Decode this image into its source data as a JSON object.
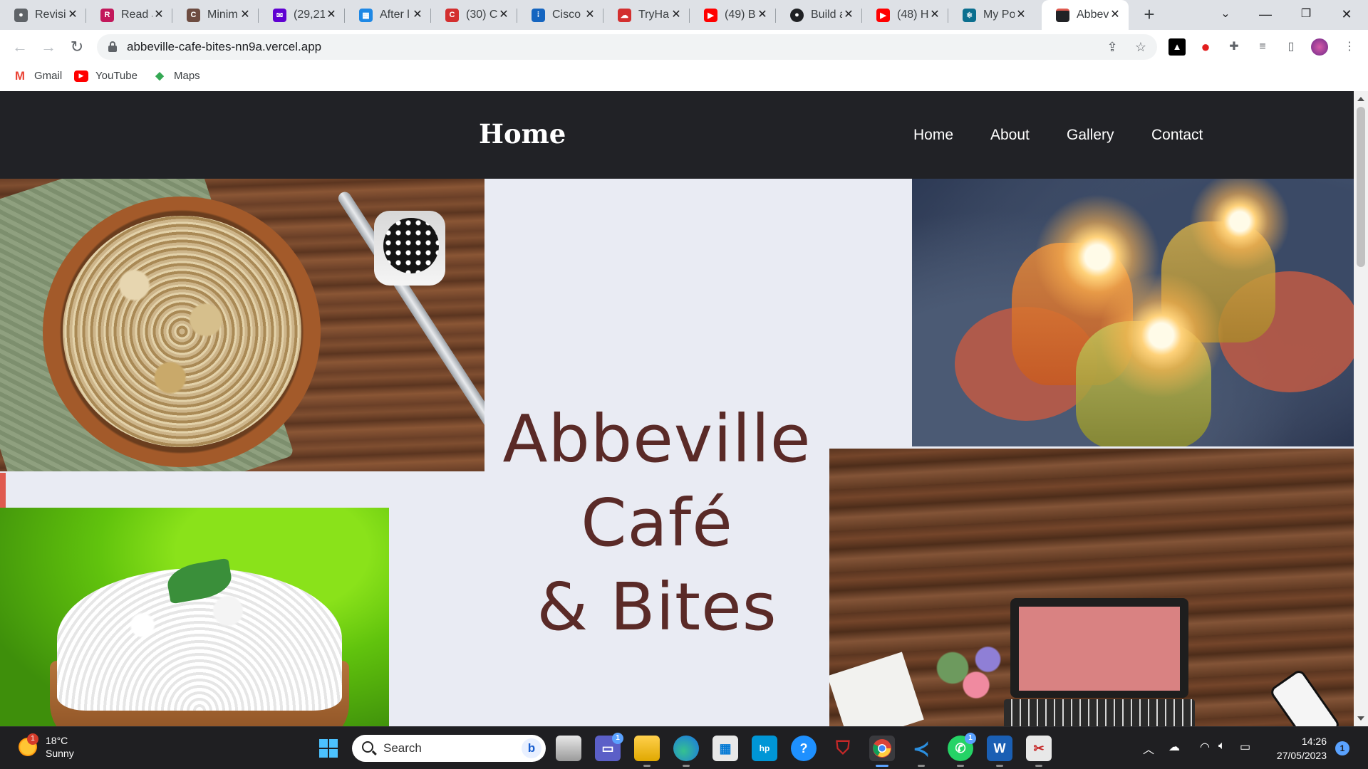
{
  "browser": {
    "tabs": [
      {
        "label": "Revisi",
        "icon": "github-icon",
        "color": "#5f6368"
      },
      {
        "label": "Read J",
        "icon": "reader-icon",
        "color": "#c2185b"
      },
      {
        "label": "Minim",
        "icon": "minimal-icon",
        "color": "#6d4c41"
      },
      {
        "label": "(29,21",
        "icon": "yahoo-mail-icon",
        "color": "#6001d2"
      },
      {
        "label": "After l",
        "icon": "photo-icon",
        "color": "#1e88e5"
      },
      {
        "label": "(30) C",
        "icon": "codewars-icon",
        "color": "#d32f2f"
      },
      {
        "label": "Cisco",
        "icon": "cisco-icon",
        "color": "#1565c0"
      },
      {
        "label": "TryHa",
        "icon": "tryhackme-icon",
        "color": "#d32f2f"
      },
      {
        "label": "(49) B",
        "icon": "youtube-icon",
        "color": "#ff0000"
      },
      {
        "label": "Build a",
        "icon": "github-icon",
        "color": "#202124"
      },
      {
        "label": "(48) H",
        "icon": "youtube-icon",
        "color": "#ff0000"
      },
      {
        "label": "My Po",
        "icon": "react-icon",
        "color": "#0b6f8f"
      },
      {
        "label": "Abbev",
        "icon": "site-icon",
        "color": "#212226"
      }
    ],
    "url": "abbeville-cafe-bites-nn9a.vercel.app",
    "bookmarks": [
      {
        "label": "Gmail",
        "icon": "gmail-icon"
      },
      {
        "label": "YouTube",
        "icon": "youtube-icon"
      },
      {
        "label": "Maps",
        "icon": "maps-icon"
      }
    ]
  },
  "site": {
    "brand": "Home",
    "nav": [
      "Home",
      "About",
      "Gallery",
      "Contact"
    ],
    "title_lines": [
      "Abbeville",
      "Café",
      "& Bites"
    ],
    "colors": {
      "nav_bg": "#212226",
      "title": "#5a2a27",
      "page_bg": "#e9ebf3",
      "accent": "#e05a4f"
    }
  },
  "taskbar": {
    "weather": {
      "temp": "18°C",
      "condition": "Sunny",
      "badge": "1"
    },
    "search_placeholder": "Search",
    "badges": {
      "teams": "1",
      "whatsapp": "1"
    },
    "time": "14:26",
    "date": "27/05/2023",
    "notifications": "1"
  }
}
